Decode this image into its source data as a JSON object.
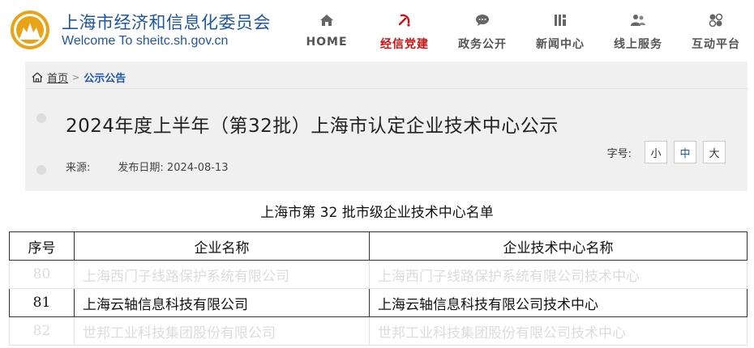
{
  "header": {
    "site_name_cn": "上海市经济和信息化委员会",
    "site_name_en": "Welcome To sheitc.sh.gov.cn",
    "nav": [
      {
        "label": "HOME",
        "icon": "home-icon",
        "active": false
      },
      {
        "label": "经信党建",
        "icon": "party-emblem-icon",
        "active": true
      },
      {
        "label": "政务公开",
        "icon": "chat-bubble-icon",
        "active": false
      },
      {
        "label": "新闻中心",
        "icon": "newspaper-icon",
        "active": false
      },
      {
        "label": "线上服务",
        "icon": "users-icon",
        "active": false
      },
      {
        "label": "互动平台",
        "icon": "interaction-icon",
        "active": false
      }
    ],
    "colors": {
      "brand": "#1f56a7",
      "active": "#d40f0f",
      "logo": "#e8a317"
    }
  },
  "breadcrumb": {
    "home": "首页",
    "separator": ">",
    "current": "公示公告"
  },
  "article": {
    "title": "2024年度上半年（第32批）上海市认定企业技术中心公示",
    "source_label": "来源:",
    "date_label": "发布日期:",
    "date": "2024-08-13",
    "font_size_label": "字号:",
    "font_sizes": [
      "小",
      "中",
      "大"
    ],
    "font_size_active": "中"
  },
  "table": {
    "title": "上海市第 32 批市级企业技术中心名单",
    "headers": [
      "序号",
      "企业名称",
      "企业技术中心名称"
    ],
    "rows": [
      {
        "idx": "80",
        "company": "上海西门子线路保护系统有限公司",
        "center": "上海西门子线路保护系统有限公司技术中心",
        "faded": true
      },
      {
        "idx": "81",
        "company": "上海云轴信息科技有限公司",
        "center": "上海云轴信息科技有限公司技术中心",
        "faded": false
      },
      {
        "idx": "82",
        "company": "世邦工业科技集团股份有限公司",
        "center": "世邦工业科技集团股份有限公司技术中心",
        "faded": true
      }
    ]
  }
}
